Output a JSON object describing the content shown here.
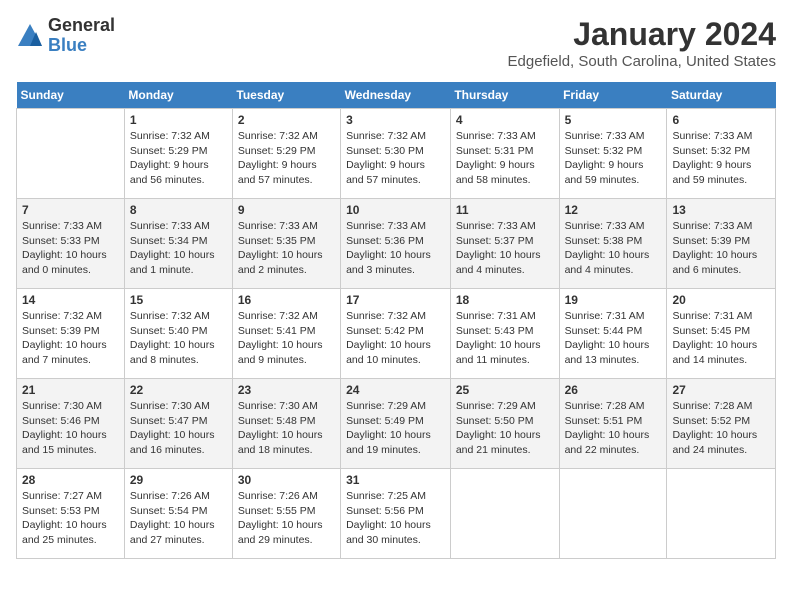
{
  "header": {
    "logo_general": "General",
    "logo_blue": "Blue",
    "title": "January 2024",
    "subtitle": "Edgefield, South Carolina, United States"
  },
  "weekdays": [
    "Sunday",
    "Monday",
    "Tuesday",
    "Wednesday",
    "Thursday",
    "Friday",
    "Saturday"
  ],
  "weeks": [
    [
      {
        "day": "",
        "sunrise": "",
        "sunset": "",
        "daylight": ""
      },
      {
        "day": "1",
        "sunrise": "Sunrise: 7:32 AM",
        "sunset": "Sunset: 5:29 PM",
        "daylight": "Daylight: 9 hours and 56 minutes."
      },
      {
        "day": "2",
        "sunrise": "Sunrise: 7:32 AM",
        "sunset": "Sunset: 5:29 PM",
        "daylight": "Daylight: 9 hours and 57 minutes."
      },
      {
        "day": "3",
        "sunrise": "Sunrise: 7:32 AM",
        "sunset": "Sunset: 5:30 PM",
        "daylight": "Daylight: 9 hours and 57 minutes."
      },
      {
        "day": "4",
        "sunrise": "Sunrise: 7:33 AM",
        "sunset": "Sunset: 5:31 PM",
        "daylight": "Daylight: 9 hours and 58 minutes."
      },
      {
        "day": "5",
        "sunrise": "Sunrise: 7:33 AM",
        "sunset": "Sunset: 5:32 PM",
        "daylight": "Daylight: 9 hours and 59 minutes."
      },
      {
        "day": "6",
        "sunrise": "Sunrise: 7:33 AM",
        "sunset": "Sunset: 5:32 PM",
        "daylight": "Daylight: 9 hours and 59 minutes."
      }
    ],
    [
      {
        "day": "7",
        "sunrise": "Sunrise: 7:33 AM",
        "sunset": "Sunset: 5:33 PM",
        "daylight": "Daylight: 10 hours and 0 minutes."
      },
      {
        "day": "8",
        "sunrise": "Sunrise: 7:33 AM",
        "sunset": "Sunset: 5:34 PM",
        "daylight": "Daylight: 10 hours and 1 minute."
      },
      {
        "day": "9",
        "sunrise": "Sunrise: 7:33 AM",
        "sunset": "Sunset: 5:35 PM",
        "daylight": "Daylight: 10 hours and 2 minutes."
      },
      {
        "day": "10",
        "sunrise": "Sunrise: 7:33 AM",
        "sunset": "Sunset: 5:36 PM",
        "daylight": "Daylight: 10 hours and 3 minutes."
      },
      {
        "day": "11",
        "sunrise": "Sunrise: 7:33 AM",
        "sunset": "Sunset: 5:37 PM",
        "daylight": "Daylight: 10 hours and 4 minutes."
      },
      {
        "day": "12",
        "sunrise": "Sunrise: 7:33 AM",
        "sunset": "Sunset: 5:38 PM",
        "daylight": "Daylight: 10 hours and 4 minutes."
      },
      {
        "day": "13",
        "sunrise": "Sunrise: 7:33 AM",
        "sunset": "Sunset: 5:39 PM",
        "daylight": "Daylight: 10 hours and 6 minutes."
      }
    ],
    [
      {
        "day": "14",
        "sunrise": "Sunrise: 7:32 AM",
        "sunset": "Sunset: 5:39 PM",
        "daylight": "Daylight: 10 hours and 7 minutes."
      },
      {
        "day": "15",
        "sunrise": "Sunrise: 7:32 AM",
        "sunset": "Sunset: 5:40 PM",
        "daylight": "Daylight: 10 hours and 8 minutes."
      },
      {
        "day": "16",
        "sunrise": "Sunrise: 7:32 AM",
        "sunset": "Sunset: 5:41 PM",
        "daylight": "Daylight: 10 hours and 9 minutes."
      },
      {
        "day": "17",
        "sunrise": "Sunrise: 7:32 AM",
        "sunset": "Sunset: 5:42 PM",
        "daylight": "Daylight: 10 hours and 10 minutes."
      },
      {
        "day": "18",
        "sunrise": "Sunrise: 7:31 AM",
        "sunset": "Sunset: 5:43 PM",
        "daylight": "Daylight: 10 hours and 11 minutes."
      },
      {
        "day": "19",
        "sunrise": "Sunrise: 7:31 AM",
        "sunset": "Sunset: 5:44 PM",
        "daylight": "Daylight: 10 hours and 13 minutes."
      },
      {
        "day": "20",
        "sunrise": "Sunrise: 7:31 AM",
        "sunset": "Sunset: 5:45 PM",
        "daylight": "Daylight: 10 hours and 14 minutes."
      }
    ],
    [
      {
        "day": "21",
        "sunrise": "Sunrise: 7:30 AM",
        "sunset": "Sunset: 5:46 PM",
        "daylight": "Daylight: 10 hours and 15 minutes."
      },
      {
        "day": "22",
        "sunrise": "Sunrise: 7:30 AM",
        "sunset": "Sunset: 5:47 PM",
        "daylight": "Daylight: 10 hours and 16 minutes."
      },
      {
        "day": "23",
        "sunrise": "Sunrise: 7:30 AM",
        "sunset": "Sunset: 5:48 PM",
        "daylight": "Daylight: 10 hours and 18 minutes."
      },
      {
        "day": "24",
        "sunrise": "Sunrise: 7:29 AM",
        "sunset": "Sunset: 5:49 PM",
        "daylight": "Daylight: 10 hours and 19 minutes."
      },
      {
        "day": "25",
        "sunrise": "Sunrise: 7:29 AM",
        "sunset": "Sunset: 5:50 PM",
        "daylight": "Daylight: 10 hours and 21 minutes."
      },
      {
        "day": "26",
        "sunrise": "Sunrise: 7:28 AM",
        "sunset": "Sunset: 5:51 PM",
        "daylight": "Daylight: 10 hours and 22 minutes."
      },
      {
        "day": "27",
        "sunrise": "Sunrise: 7:28 AM",
        "sunset": "Sunset: 5:52 PM",
        "daylight": "Daylight: 10 hours and 24 minutes."
      }
    ],
    [
      {
        "day": "28",
        "sunrise": "Sunrise: 7:27 AM",
        "sunset": "Sunset: 5:53 PM",
        "daylight": "Daylight: 10 hours and 25 minutes."
      },
      {
        "day": "29",
        "sunrise": "Sunrise: 7:26 AM",
        "sunset": "Sunset: 5:54 PM",
        "daylight": "Daylight: 10 hours and 27 minutes."
      },
      {
        "day": "30",
        "sunrise": "Sunrise: 7:26 AM",
        "sunset": "Sunset: 5:55 PM",
        "daylight": "Daylight: 10 hours and 29 minutes."
      },
      {
        "day": "31",
        "sunrise": "Sunrise: 7:25 AM",
        "sunset": "Sunset: 5:56 PM",
        "daylight": "Daylight: 10 hours and 30 minutes."
      },
      {
        "day": "",
        "sunrise": "",
        "sunset": "",
        "daylight": ""
      },
      {
        "day": "",
        "sunrise": "",
        "sunset": "",
        "daylight": ""
      },
      {
        "day": "",
        "sunrise": "",
        "sunset": "",
        "daylight": ""
      }
    ]
  ]
}
